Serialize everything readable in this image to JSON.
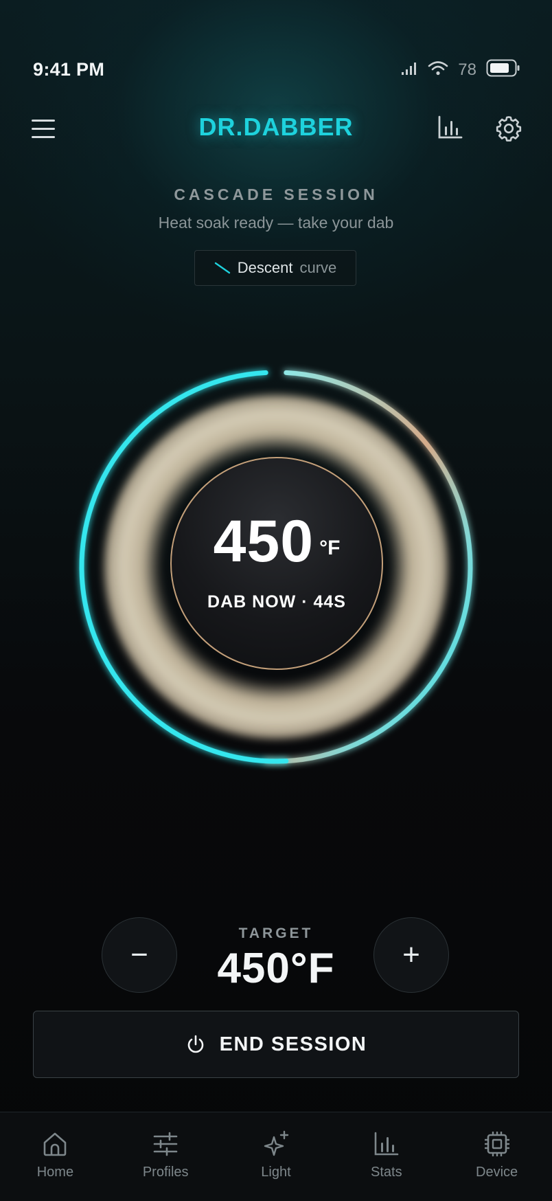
{
  "status_bar": {
    "time": "9:41 PM",
    "battery_percent": "78"
  },
  "header": {
    "brand": "DR.DABBER"
  },
  "session": {
    "title": "CASCADE SESSION",
    "subtitle": "Heat soak ready — take your dab",
    "curve_name": "Descent",
    "curve_suffix": "curve"
  },
  "dial": {
    "temperature": "450",
    "unit": "°F",
    "status": "DAB NOW · 44S",
    "colors": {
      "ring_accent": "#36e6ee",
      "ring_warm": "#d2a78a",
      "inner_border": "#c4a07a"
    }
  },
  "target": {
    "label": "TARGET",
    "value": "450°F",
    "decrement_glyph": "−",
    "increment_glyph": "+"
  },
  "actions": {
    "end_session_label": "END SESSION"
  },
  "nav": {
    "items": [
      {
        "label": "Home",
        "icon": "home-icon"
      },
      {
        "label": "Profiles",
        "icon": "sliders-icon"
      },
      {
        "label": "Light",
        "icon": "sparkle-icon"
      },
      {
        "label": "Stats",
        "icon": "bar-chart-icon"
      },
      {
        "label": "Device",
        "icon": "chip-icon"
      }
    ]
  },
  "theme": {
    "accent": "#1ed2dd",
    "background": "#070a0c"
  }
}
